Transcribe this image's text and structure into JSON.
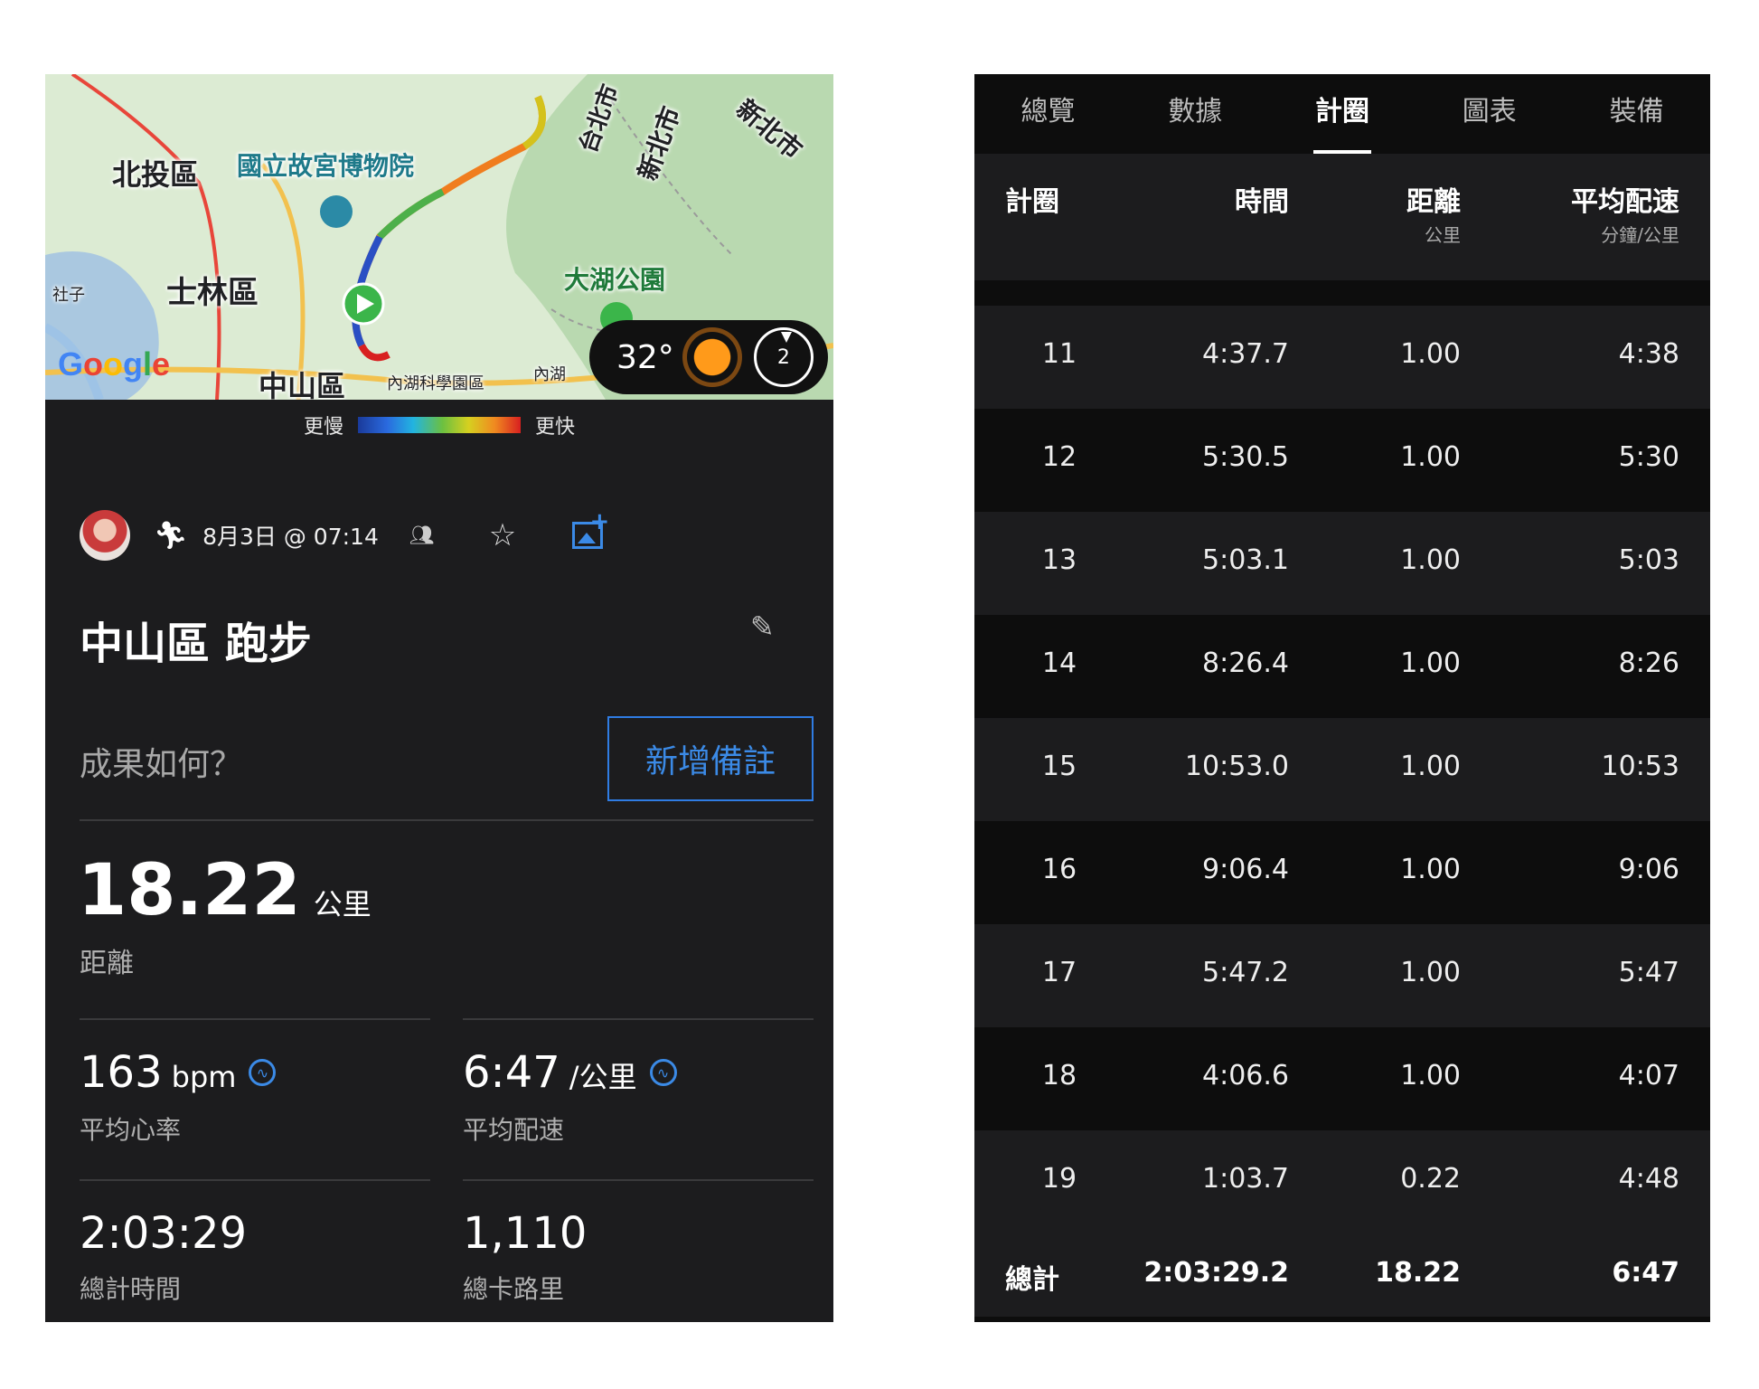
{
  "map": {
    "labels": {
      "beitou": "北投區",
      "palace_museum": "國立故宮博物院",
      "shilin": "士林區",
      "shezi": "社子",
      "zhongshan": "中山區",
      "neihu_park": "內湖科學園區",
      "neihu": "內湖",
      "dahu_park": "大湖公園",
      "taipei_city": "台北市",
      "new_taipei": "新北市",
      "new_taipei_2": "新北市"
    },
    "logo": "Google",
    "weather": {
      "temp": "32°",
      "wind": "2"
    }
  },
  "legend": {
    "slower": "更慢",
    "faster": "更快"
  },
  "activity": {
    "date": "8月3日 @ 07:14",
    "title": "中山區 跑步",
    "prompt": "成果如何？",
    "add_note": "新增備註",
    "distance": {
      "value": "18.22",
      "unit": "公里",
      "label": "距離"
    },
    "heart_rate": {
      "value": "163",
      "unit": "bpm",
      "label": "平均心率"
    },
    "pace": {
      "value": "6:47",
      "unit": "/公里",
      "label": "平均配速"
    },
    "total_time": {
      "value": "2:03:29",
      "label": "總計時間"
    },
    "calories": {
      "value": "1,110",
      "label": "總卡路里"
    }
  },
  "tabs": [
    "總覽",
    "數據",
    "計圈",
    "圖表",
    "裝備"
  ],
  "laps_table": {
    "headers": {
      "lap": "計圈",
      "time": "時間",
      "distance": "距離",
      "distance_unit": "公里",
      "pace": "平均配速",
      "pace_unit": "分鐘/公里"
    },
    "rows": [
      {
        "lap": "11",
        "time": "4:37.7",
        "distance": "1.00",
        "pace": "4:38"
      },
      {
        "lap": "12",
        "time": "5:30.5",
        "distance": "1.00",
        "pace": "5:30"
      },
      {
        "lap": "13",
        "time": "5:03.1",
        "distance": "1.00",
        "pace": "5:03"
      },
      {
        "lap": "14",
        "time": "8:26.4",
        "distance": "1.00",
        "pace": "8:26"
      },
      {
        "lap": "15",
        "time": "10:53.0",
        "distance": "1.00",
        "pace": "10:53"
      },
      {
        "lap": "16",
        "time": "9:06.4",
        "distance": "1.00",
        "pace": "9:06"
      },
      {
        "lap": "17",
        "time": "5:47.2",
        "distance": "1.00",
        "pace": "5:47"
      },
      {
        "lap": "18",
        "time": "4:06.6",
        "distance": "1.00",
        "pace": "4:07"
      },
      {
        "lap": "19",
        "time": "1:03.7",
        "distance": "0.22",
        "pace": "4:48"
      }
    ],
    "total": {
      "lap": "總計",
      "time": "2:03:29.2",
      "distance": "18.22",
      "pace": "6:47"
    }
  },
  "colors": {
    "accent": "#3b8ae6",
    "panel": "#1c1c1e",
    "background": "#0d0d0d"
  }
}
